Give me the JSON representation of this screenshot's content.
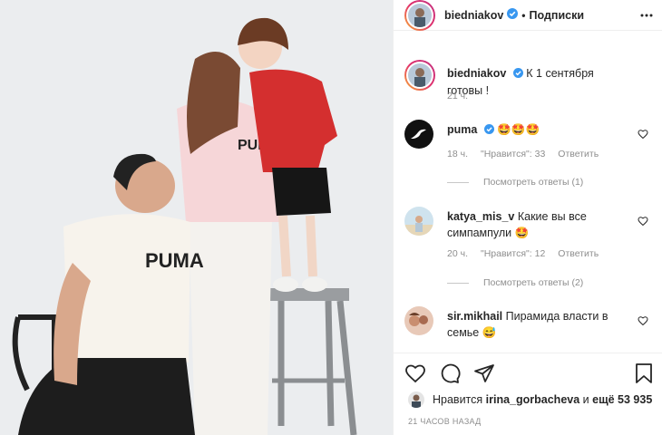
{
  "header": {
    "username": "biedniakov",
    "separator": "•",
    "follow_label": "Подписки"
  },
  "caption": {
    "username": "biedniakov",
    "text": "К 1 сентября готовы !",
    "time": "21 ч."
  },
  "comments": [
    {
      "username": "puma",
      "text": "🤩🤩🤩",
      "time": "18 ч.",
      "likes_label": "\"Нравится\": 33",
      "reply_label": "Ответить",
      "view_replies": "Посмотреть ответы (1)"
    },
    {
      "username": "katya_mis_v",
      "text": "Какие вы все симпампули 🤩",
      "time": "20 ч.",
      "likes_label": "\"Нравится\": 12",
      "reply_label": "Ответить",
      "view_replies": "Посмотреть ответы (2)"
    },
    {
      "username": "sir.mikhail",
      "text": "Пирамида власти в семье 😅"
    }
  ],
  "likes": {
    "prefix": "Нравится",
    "user": "irina_gorbacheva",
    "middle": "и",
    "others": "ещё 53 935"
  },
  "post_time": "21 ЧАСОВ НАЗАД",
  "photo": {
    "tshirt_print_1": "PUMA",
    "tshirt_print_2": "PUMA"
  },
  "colors": {
    "verified": "#3897f0",
    "muted": "#8e8e8e",
    "text": "#262626"
  }
}
